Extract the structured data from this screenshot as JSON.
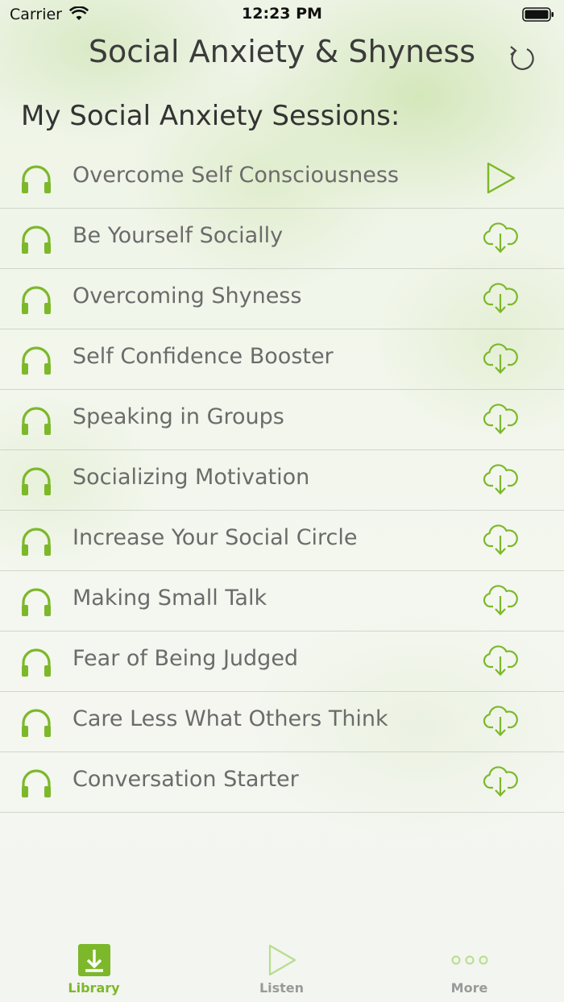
{
  "status_bar": {
    "carrier": "Carrier",
    "time": "12:23 PM"
  },
  "header": {
    "title": "Social Anxiety & Shyness"
  },
  "section": {
    "title": "My Social Anxiety Sessions:"
  },
  "sessions": [
    {
      "title": "Overcome Self Consciousness",
      "action": "play"
    },
    {
      "title": "Be Yourself Socially",
      "action": "download"
    },
    {
      "title": "Overcoming Shyness",
      "action": "download"
    },
    {
      "title": "Self Confidence Booster",
      "action": "download"
    },
    {
      "title": "Speaking in Groups",
      "action": "download"
    },
    {
      "title": "Socializing Motivation",
      "action": "download"
    },
    {
      "title": "Increase Your Social Circle",
      "action": "download"
    },
    {
      "title": "Making Small Talk",
      "action": "download"
    },
    {
      "title": "Fear of Being Judged",
      "action": "download"
    },
    {
      "title": "Care Less What Others Think",
      "action": "download"
    },
    {
      "title": "Conversation Starter",
      "action": "download"
    }
  ],
  "tabs": [
    {
      "label": "Library",
      "icon": "library-download-icon",
      "active": true
    },
    {
      "label": "Listen",
      "icon": "play-outline-icon",
      "active": false
    },
    {
      "label": "More",
      "icon": "more-dots-icon",
      "active": false
    }
  ],
  "colors": {
    "accent": "#7cb82a",
    "inactive": "#9a9a9a",
    "text": "#6b6b6b"
  }
}
